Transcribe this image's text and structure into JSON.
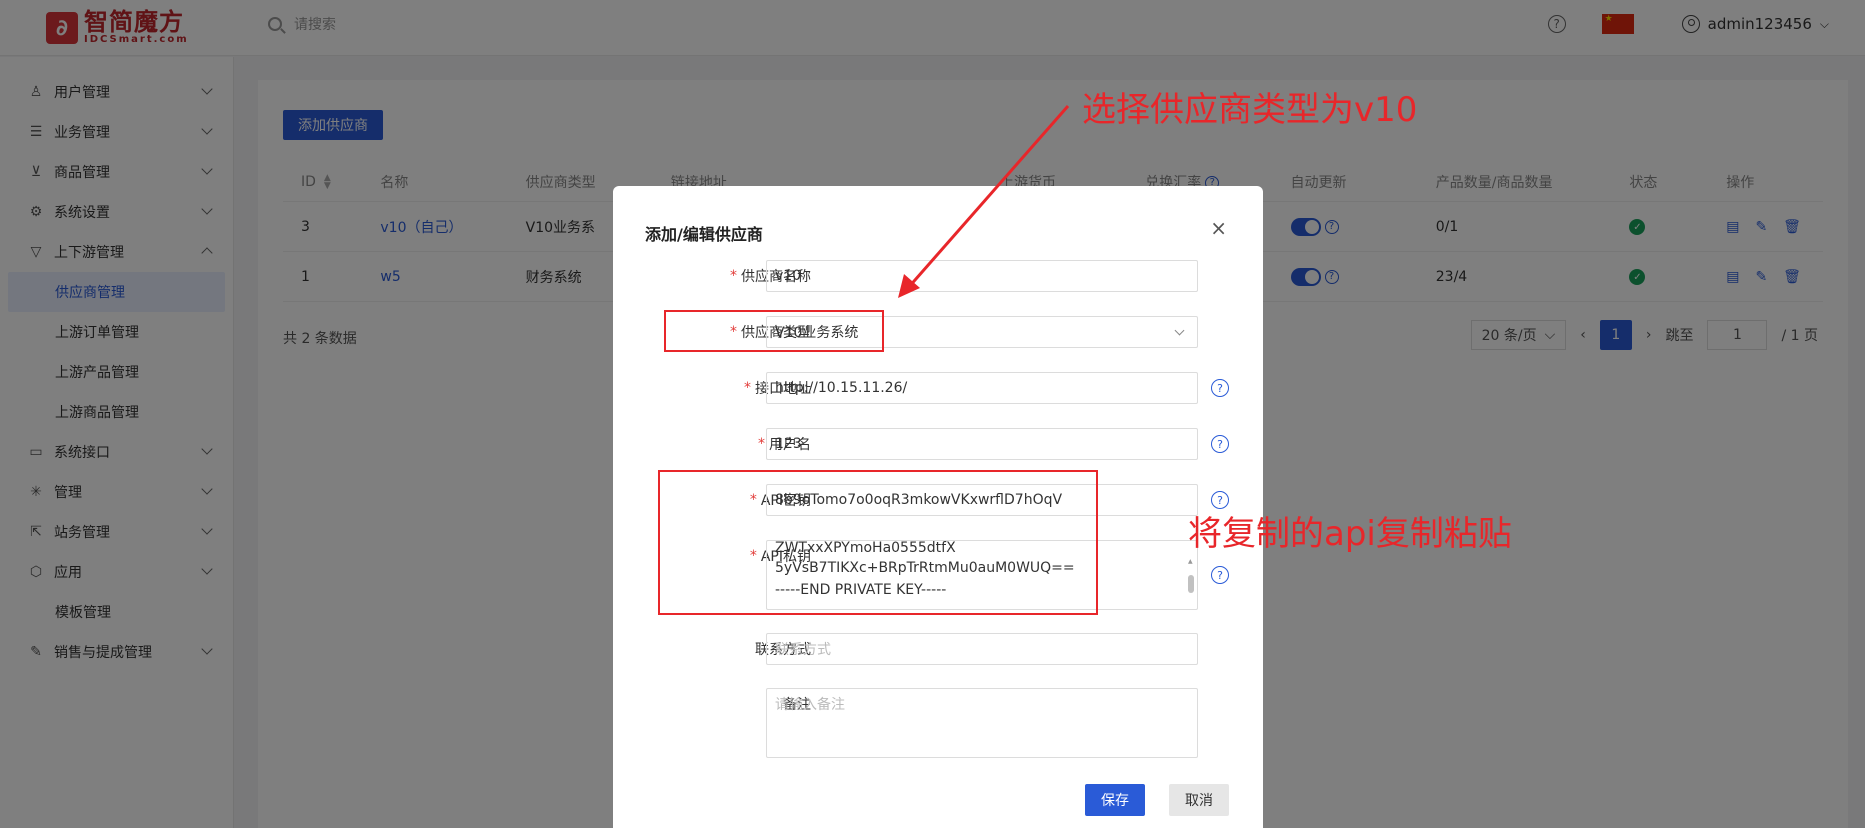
{
  "header": {
    "logo_cn": "智简魔方",
    "logo_en": "IDCSmart.com",
    "search_placeholder": "请搜索",
    "help": "?",
    "username": "admin123456"
  },
  "sidebar": {
    "items": [
      {
        "label": "用户管理",
        "icon": "user-icon"
      },
      {
        "label": "业务管理",
        "icon": "list-icon"
      },
      {
        "label": "商品管理",
        "icon": "cart-icon"
      },
      {
        "label": "系统设置",
        "icon": "gear-icon"
      },
      {
        "label": "上下游管理",
        "icon": "filter-icon"
      },
      {
        "label": "系统接口",
        "icon": "folder-icon"
      },
      {
        "label": "管理",
        "icon": "snowflake-icon"
      },
      {
        "label": "站务管理",
        "icon": "share-icon"
      },
      {
        "label": "应用",
        "icon": "cube-icon"
      },
      {
        "label": "销售与提成管理",
        "icon": "wrench-icon"
      }
    ],
    "sub_updown": [
      "供应商管理",
      "上游订单管理",
      "上游产品管理",
      "上游商品管理"
    ],
    "sub_app": [
      "模板管理"
    ]
  },
  "page": {
    "add_button": "添加供应商",
    "columns": [
      "ID",
      "名称",
      "供应商类型",
      "链接地址",
      "上游货币",
      "兑换汇率",
      "自动更新",
      "产品数量/商品数量",
      "状态",
      "操作"
    ],
    "rows": [
      {
        "id": "3",
        "name": "v10（自己）",
        "type": "V10业务系",
        "qty": "0/1"
      },
      {
        "id": "1",
        "name": "w5",
        "type": "财务系统",
        "qty": "23/4"
      }
    ],
    "total": "共 2 条数据",
    "page_size": "20 条/页",
    "current_page": "1",
    "jump_label": "跳至",
    "jump_value": "1",
    "page_total": "/ 1 页"
  },
  "modal": {
    "title": "添加/编辑供应商",
    "close": "×",
    "fields": {
      "name_label": "供应商名称",
      "name_value": "v10",
      "type_label": "供应商类型",
      "type_value": "V10业务系统",
      "url_label": "接口地址",
      "url_value": "http://10.15.11.26/",
      "user_label": "用户名",
      "user_value": "123",
      "key_label": "API密钥",
      "key_value": "8b9oTomo7o0oqR3mkowVKxwrflD7hOqV",
      "private_label": "API私钥",
      "private_line1": "ZWTxxXPYmoHa0555dtfX",
      "private_line2": "5yVsB7TIKXc+BRpTrRtmMu0auM0WUQ==",
      "private_line3": "-----END PRIVATE KEY-----",
      "contact_label": "联系方式",
      "contact_placeholder": "联系方式",
      "note_label": "备注",
      "note_placeholder": "请输入备注"
    },
    "save": "保存",
    "cancel": "取消"
  },
  "annotations": {
    "top_text": "选择供应商类型为v10",
    "right_text": "将复制的api复制粘贴",
    "color": "#e8262a"
  },
  "colors": {
    "primary": "#2a5bd7",
    "danger": "#e23c39",
    "success": "#19a05a"
  }
}
